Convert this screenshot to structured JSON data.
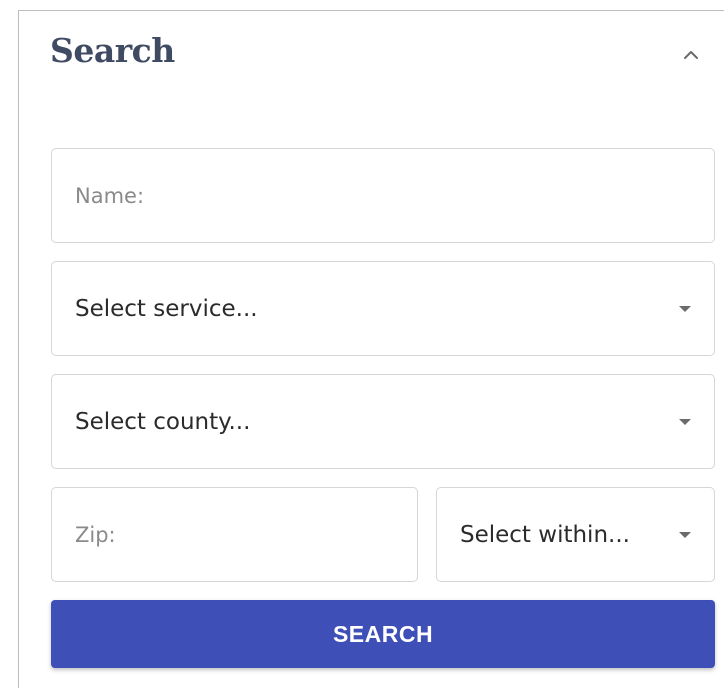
{
  "panel": {
    "title": "Search",
    "collapse_icon": "chevron-up-icon"
  },
  "form": {
    "name_placeholder": "Name:",
    "service_selected": "Select service...",
    "county_selected": "Select county...",
    "zip_placeholder": "Zip:",
    "within_selected": "Select within...",
    "submit_label": "SEARCH"
  },
  "colors": {
    "title": "#3f4a63",
    "button_bg": "#3f4fb8",
    "button_text": "#ffffff",
    "field_border": "#d6d6d6"
  }
}
